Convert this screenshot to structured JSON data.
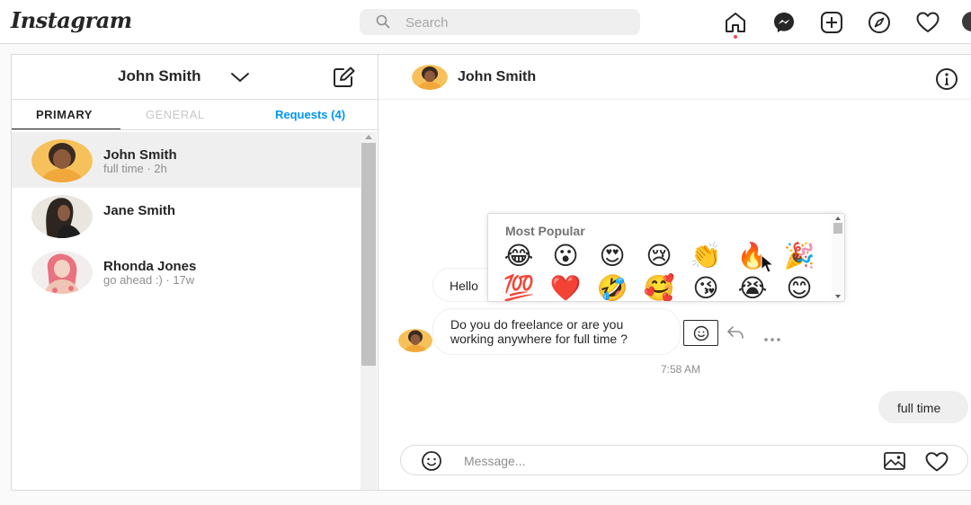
{
  "app": {
    "logo": "Instagram"
  },
  "search": {
    "placeholder": "Search"
  },
  "nav": {
    "icons": [
      "home-icon",
      "messenger-icon",
      "new-post-icon",
      "explore-icon",
      "activity-heart-icon",
      "profile-avatar"
    ]
  },
  "inbox": {
    "account_name": "John Smith",
    "tabs": {
      "primary": "PRIMARY",
      "general": "GENERAL",
      "requests": "Requests (4)"
    },
    "threads": [
      {
        "name": "John Smith",
        "subtitle": "full time · 2h",
        "active": true
      },
      {
        "name": "Jane Smith",
        "subtitle": ""
      },
      {
        "name": "Rhonda Jones",
        "subtitle": "go ahead :) · 17w"
      }
    ]
  },
  "chat": {
    "header_name": "John Smith",
    "messages": {
      "hello": "Hello",
      "question_line1": "Do you do freelance or are you",
      "question_line2": "working anywhere for full time ?",
      "timestamp": "7:58 AM",
      "my_reply": "full time"
    },
    "composer_placeholder": "Message..."
  },
  "emoji_picker": {
    "title": "Most Popular",
    "emojis": [
      "😂",
      "😮",
      "😍",
      "😢",
      "👏",
      "🔥",
      "🎉",
      "💯",
      "❤️",
      "🤣",
      "🥰",
      "😘",
      "😭",
      "😊"
    ]
  },
  "colors": {
    "accent": "#0095f6",
    "notification": "#ed4956",
    "text": "#262626",
    "muted": "#8e8e8e"
  }
}
